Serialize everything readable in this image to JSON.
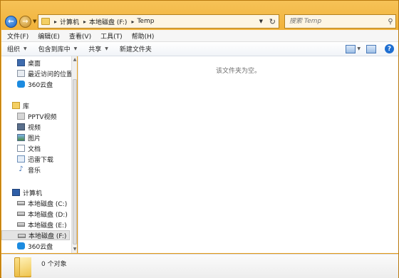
{
  "address": {
    "crumbs": [
      "计算机",
      "本地磁盘 (F:)",
      "Temp"
    ]
  },
  "search": {
    "placeholder": "搜索 Temp"
  },
  "menu": [
    "文件(F)",
    "编辑(E)",
    "查看(V)",
    "工具(T)",
    "帮助(H)"
  ],
  "toolbar": {
    "organize": "组织",
    "include_in_library": "包含到库中",
    "share": "共享",
    "new_folder": "新建文件夹"
  },
  "nav": {
    "favorites": [
      "桌面",
      "最近访问的位置",
      "360云盘"
    ],
    "libraries_title": "库",
    "libraries": [
      "PPTV视频",
      "视频",
      "图片",
      "文档",
      "迅雷下载",
      "音乐"
    ],
    "computer_title": "计算机",
    "drives": [
      "本地磁盘 (C:)",
      "本地磁盘 (D:)",
      "本地磁盘 (E:)",
      "本地磁盘 (F:)"
    ],
    "cloud": "360云盘"
  },
  "content": {
    "empty_message": "该文件夹为空。"
  },
  "details": {
    "item_count": "0 个对象"
  }
}
